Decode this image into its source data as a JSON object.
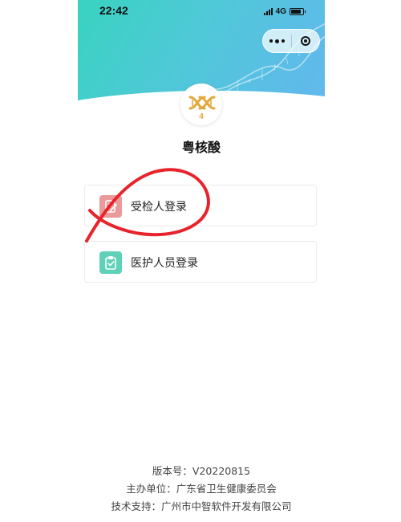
{
  "status_bar": {
    "time": "22:42",
    "network": "4G"
  },
  "capsule": {
    "more_icon": "more-dots-icon",
    "close_icon": "target-circle-icon"
  },
  "app": {
    "logo_icon": "dna-logo-icon",
    "logo_number": "4",
    "title": "粤核酸"
  },
  "login_options": [
    {
      "label": "受检人登录",
      "icon": "edit-document-icon",
      "color": "#ea9a9a"
    },
    {
      "label": "医护人员登录",
      "icon": "clipboard-icon",
      "color": "#5fd1b8"
    }
  ],
  "footer": {
    "version": "版本号：V20220815",
    "organizer": "主办单位：广东省卫生健康委员会",
    "tech_support": "技术支持：广州市中智软件开发有限公司"
  },
  "colors": {
    "header_gradient_start": "#39d3c0",
    "header_gradient_end": "#63b7ee",
    "logo_gold": "#e2a93b",
    "annotation_red": "#e8232c"
  }
}
